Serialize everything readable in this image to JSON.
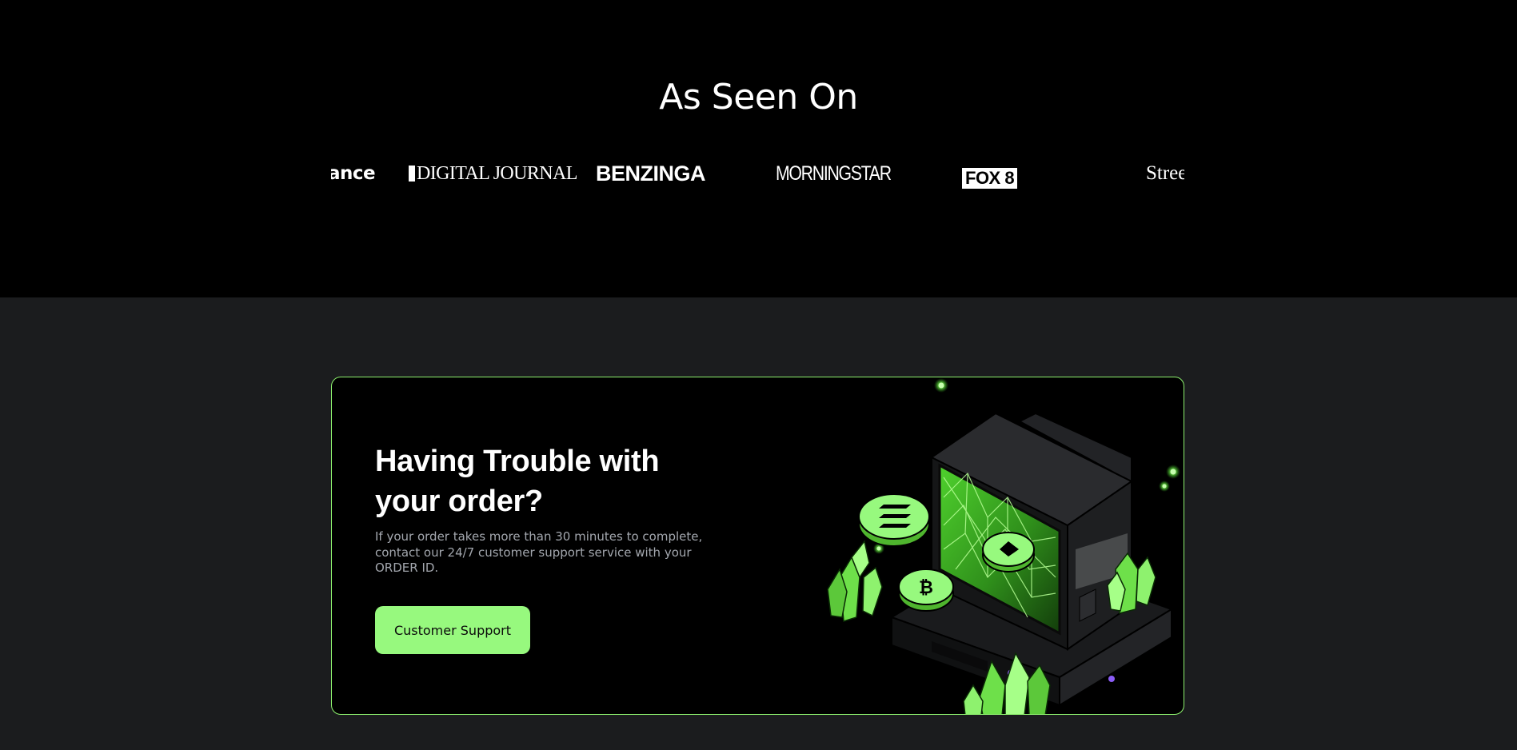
{
  "as_seen_on": {
    "title": "As Seen On",
    "logos": [
      {
        "name": "finance",
        "text": "ance"
      },
      {
        "name": "digital-journal",
        "text": "DIGITAL JOURNAL"
      },
      {
        "name": "benzinga",
        "text": "BENZINGA"
      },
      {
        "name": "morningstar",
        "text": "MORNINGSTAR"
      },
      {
        "name": "fox8",
        "text": "FOX 8"
      },
      {
        "name": "street",
        "text": "Stree"
      }
    ]
  },
  "support_card": {
    "title": "Having Trouble with your order?",
    "description": "If your order takes more than 30 minutes to complete, contact our 24/7 customer support service with your ORDER ID.",
    "button_label": "Customer Support"
  },
  "colors": {
    "accent": "#97f97e",
    "border": "#8ef26e",
    "page_bg_top": "#000000",
    "page_bg_bottom": "#1b1c1e",
    "card_bg": "#000000",
    "muted_text": "#a3a7ae"
  },
  "icons": [
    "solana-coin-icon",
    "ethereum-coin-icon",
    "bitcoin-coin-icon",
    "computer-illustration",
    "crystal-icon"
  ]
}
